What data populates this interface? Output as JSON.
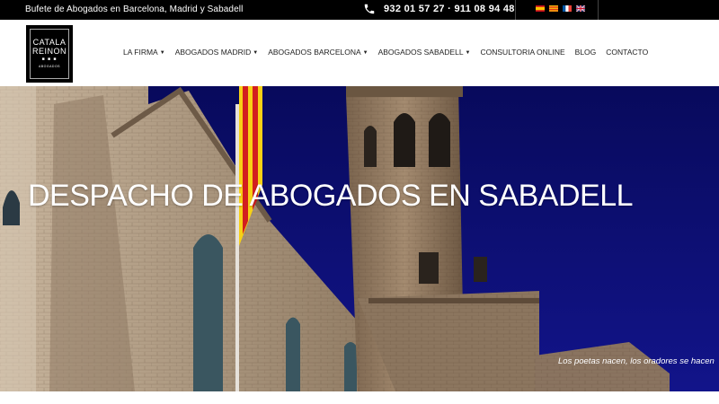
{
  "topbar": {
    "tagline": "Bufete de Abogados en Barcelona, Madrid y Sabadell",
    "phones": "932 01 57 27 · 911 08 94 48",
    "phone_icon": "phone-icon",
    "languages": [
      "es",
      "ca",
      "fr",
      "en"
    ]
  },
  "logo": {
    "line1": "CATALA",
    "line2": "REINON",
    "stars": "■ ■ ■",
    "line3": "ABOGADOS"
  },
  "nav": {
    "items": [
      {
        "label": "LA FIRMA",
        "dropdown": true
      },
      {
        "label": "ABOGADOS MADRID",
        "dropdown": true
      },
      {
        "label": "ABOGADOS BARCELONA",
        "dropdown": true
      },
      {
        "label": "ABOGADOS SABADELL",
        "dropdown": true
      },
      {
        "label": "CONSULTORIA ONLINE",
        "dropdown": false
      },
      {
        "label": "BLOG",
        "dropdown": false
      },
      {
        "label": "CONTACTO",
        "dropdown": false
      }
    ],
    "caret": "▼"
  },
  "hero": {
    "title": "DESPACHO DE ABOGADOS EN SABADELL",
    "quote": "Los poetas nacen, los oradores se hacen"
  },
  "colors": {
    "sky": "#0b0c6e",
    "stone": "#8a7560",
    "topbar": "#000000"
  }
}
